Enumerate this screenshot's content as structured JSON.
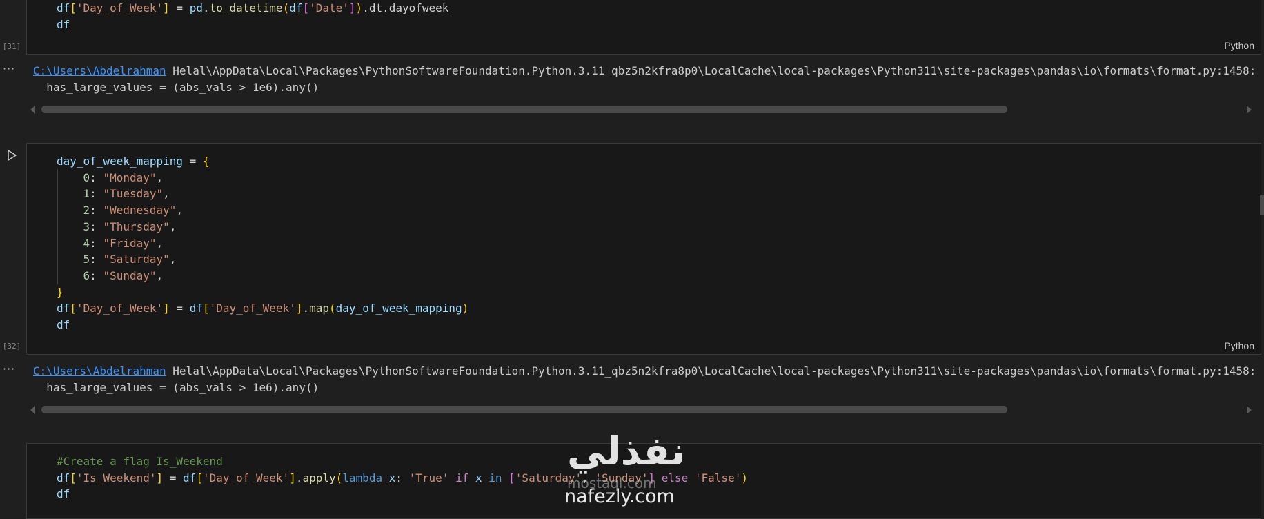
{
  "cells": [
    {
      "exec_count": "[31]",
      "language": "Python",
      "code_lines": [
        "df['Day_of_Week'] = pd.to_datetime(df['Date']).dt.dayofweek",
        "df"
      ]
    },
    {
      "exec_count": "[32]",
      "language": "Python",
      "code_lines": [
        "day_of_week_mapping = {",
        "    0: \"Monday\",",
        "    1: \"Tuesday\",",
        "    2: \"Wednesday\",",
        "    3: \"Thursday\",",
        "    4: \"Friday\",",
        "    5: \"Saturday\",",
        "    6: \"Sunday\",",
        "}",
        "df['Day_of_Week'] = df['Day_of_Week'].map(day_of_week_mapping)",
        "df"
      ]
    },
    {
      "exec_count": "",
      "language": "",
      "code_lines": [
        "#Create a flag Is_Weekend",
        "df['Is_Weekend'] = df['Day_of_Week'].apply(lambda x: 'True' if x in ['Saturday', 'Sunday'] else 'False')",
        "df"
      ]
    }
  ],
  "outputs": [
    {
      "more_icon": "ellipsis-icon",
      "path_link": "C:\\Users\\Abdelrahman",
      "path_rest": " Helal\\AppData\\Local\\Packages\\PythonSoftwareFoundation.Python.3.11_qbz5n2kfra8p0\\LocalCache\\local-packages\\Python311\\site-packages\\pandas\\io\\formats\\format.py:1458:",
      "line2": "  has_large_values = (abs_vals > 1e6).any()"
    },
    {
      "more_icon": "ellipsis-icon",
      "path_link": "C:\\Users\\Abdelrahman",
      "path_rest": " Helal\\AppData\\Local\\Packages\\PythonSoftwareFoundation.Python.3.11_qbz5n2kfra8p0\\LocalCache\\local-packages\\Python311\\site-packages\\pandas\\io\\formats\\format.py:1458:",
      "line2": "  has_large_values = (abs_vals > 1e6).any()"
    }
  ],
  "run_icon": "play-icon",
  "watermark": {
    "arabic": "نفذلي",
    "faint": "mostaql.com",
    "latin": "nafezly.com"
  },
  "colors": {
    "background": "#1f1f1f",
    "cell_background": "#181818",
    "link": "#3794ff",
    "string": "#ce9178",
    "variable": "#9cdcfe",
    "comment": "#6a9955"
  }
}
